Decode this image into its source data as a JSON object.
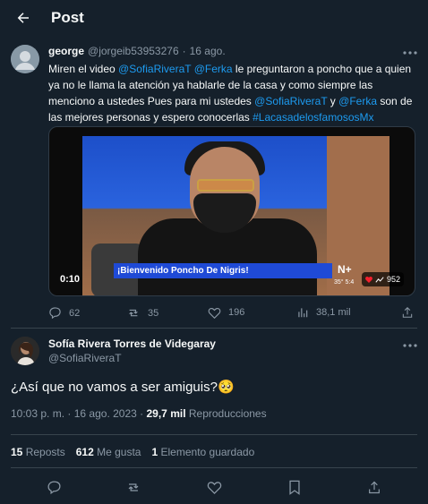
{
  "header": {
    "title": "Post"
  },
  "quoted_tweet": {
    "name": "george",
    "handle": "@jorgeib53953276",
    "separator": "·",
    "date": "16 ago.",
    "text_parts": [
      "Miren el video ",
      "@SofiaRiveraT",
      " ",
      "@Ferka",
      " le preguntaron a poncho que a quien ya no le llama la atención ya hablarle de la casa y como siempre las menciono a ustedes Pues para mi ustedes ",
      "@SofiaRiveraT",
      " y ",
      "@Ferka",
      " son de las mejores personas y espero conocerlas ",
      "#LacasadelosfamososMx"
    ],
    "video": {
      "caption": "¡Bienvenido Poncho De Nigris!",
      "time": "0:10",
      "views": "952",
      "logo": "N+",
      "temperature": "35°",
      "clock": "5:4"
    },
    "actions": {
      "replies": "62",
      "reposts": "35",
      "likes": "196",
      "views": "38,1 mil"
    }
  },
  "main_tweet": {
    "name": "Sofía Rivera Torres de Videgaray",
    "handle": "@SofiaRiveraT",
    "text": "¿Así que no vamos a ser amiguis?🥺",
    "time": "10:03 p. m.",
    "separator": "·",
    "date": "16 ago. 2023",
    "separator2": "·",
    "views_count": "29,7 mil",
    "views_label": "Reproducciones",
    "reposts_count": "15",
    "reposts_label": "Reposts",
    "likes_count": "612",
    "likes_label": "Me gusta",
    "saved_count": "1",
    "saved_label": "Elemento guardado"
  },
  "colors": {
    "background": "#15202b",
    "link": "#1d9bf0",
    "muted": "#8b98a5",
    "divider": "#38444d"
  },
  "icons": [
    "back-arrow-icon",
    "more-icon",
    "reply-icon",
    "repost-icon",
    "like-icon",
    "views-icon",
    "share-icon",
    "bookmark-icon",
    "heart-icon"
  ]
}
